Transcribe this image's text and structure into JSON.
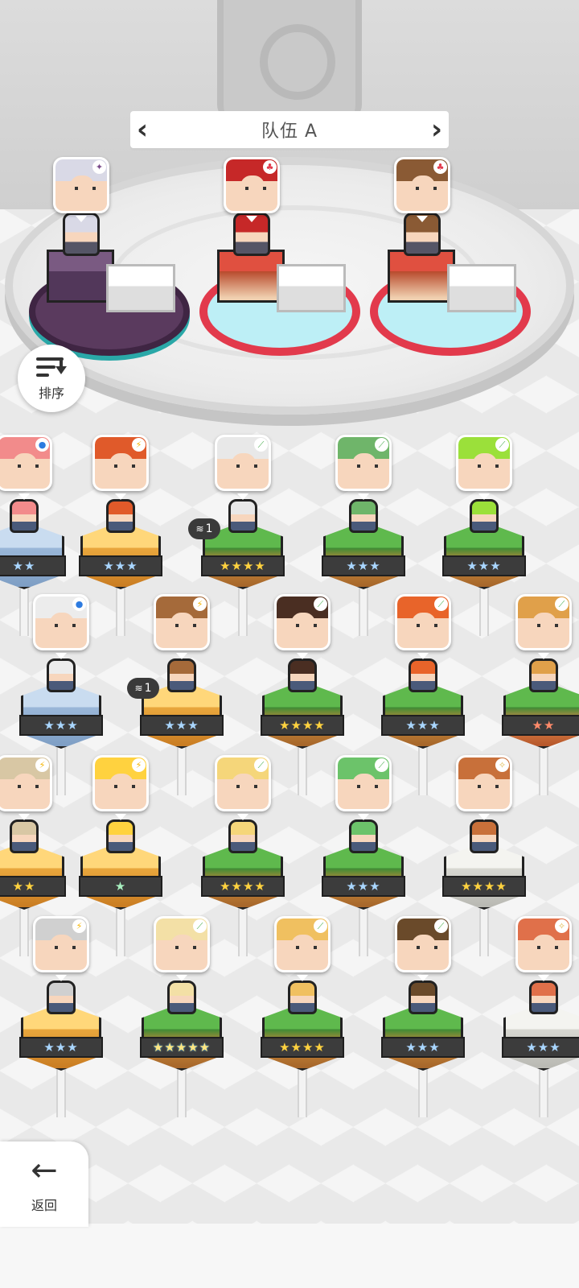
{
  "header": {
    "title": "队伍 A",
    "prev_icon": "chevron-left-icon",
    "next_icon": "chevron-right-icon"
  },
  "team_slots": [
    {
      "element_icon": "✦",
      "element_color": "#7a4a8a",
      "hair": "#d9d9e6",
      "theme": "dark"
    },
    {
      "element_icon": "♣",
      "element_color": "#e23a4c",
      "hair": "#c62828",
      "theme": "red"
    },
    {
      "element_icon": "♣",
      "element_color": "#e23a4c",
      "hair": "#8a5a34",
      "theme": "red"
    }
  ],
  "sort_button": {
    "label": "排序",
    "icon": "sort-icon"
  },
  "back_button": {
    "label": "返回",
    "icon": "arrow-left-icon"
  },
  "roster": [
    {
      "stars": "★★",
      "star_color": "blue",
      "pedestal": "blue",
      "element_icon": "●",
      "element_color": "#2d7be0",
      "hair": "#f28b8b"
    },
    {
      "stars": "★★★",
      "star_color": "blue",
      "pedestal": "gold",
      "element_icon": "⚡",
      "element_color": "#f5b400",
      "hair": "#e05a2a"
    },
    {
      "stars": "★★★★",
      "star_color": "gold",
      "pedestal": "green",
      "element_icon": "⟋",
      "element_color": "#4caf50",
      "hair": "#e8e8e8",
      "dup_count": "1"
    },
    {
      "stars": "★★★",
      "star_color": "blue",
      "pedestal": "green",
      "element_icon": "⟋",
      "element_color": "#4caf50",
      "hair": "#6fb56a"
    },
    {
      "stars": "★★★",
      "star_color": "blue",
      "pedestal": "green",
      "element_icon": "⟋",
      "element_color": "#4caf50",
      "hair": "#9be03a"
    },
    {
      "stars": "★★★",
      "star_color": "blue",
      "pedestal": "blue",
      "element_icon": "●",
      "element_color": "#2d7be0",
      "hair": "#ececec"
    },
    {
      "stars": "★★★",
      "star_color": "blue",
      "pedestal": "gold",
      "element_icon": "⚡",
      "element_color": "#f5b400",
      "hair": "#a56a3a",
      "dup_count": "1"
    },
    {
      "stars": "★★★★",
      "star_color": "gold",
      "pedestal": "green",
      "element_icon": "⟋",
      "element_color": "#4caf50",
      "hair": "#4a2e22"
    },
    {
      "stars": "★★★",
      "star_color": "blue",
      "pedestal": "green",
      "element_icon": "⟋",
      "element_color": "#4caf50",
      "hair": "#e8642a"
    },
    {
      "stars": "★★",
      "star_color": "red",
      "pedestal": "orange",
      "element_icon": "⟋",
      "element_color": "#4caf50",
      "hair": "#e0a04a"
    },
    {
      "stars": "★★",
      "star_color": "gold",
      "pedestal": "gold",
      "element_icon": "⚡",
      "element_color": "#f5b400",
      "hair": "#d8c7a4"
    },
    {
      "stars": "★",
      "star_color": "green",
      "pedestal": "gold",
      "element_icon": "⚡",
      "element_color": "#f5b400",
      "hair": "#ffd23f"
    },
    {
      "stars": "★★★★",
      "star_color": "gold",
      "pedestal": "green",
      "element_icon": "⟋",
      "element_color": "#4caf50",
      "hair": "#f5d67a"
    },
    {
      "stars": "★★★",
      "star_color": "blue",
      "pedestal": "green",
      "element_icon": "⟋",
      "element_color": "#4caf50",
      "hair": "#6cc36a"
    },
    {
      "stars": "★★★★",
      "star_color": "gold",
      "pedestal": "white",
      "element_icon": "✧",
      "element_color": "#e0b84a",
      "hair": "#c8703a"
    },
    {
      "stars": "★★★",
      "star_color": "blue",
      "pedestal": "gold",
      "element_icon": "⚡",
      "element_color": "#f5b400",
      "hair": "#d0d0d0"
    },
    {
      "stars": "★★★★★",
      "star_color": "rainbow",
      "pedestal": "green",
      "element_icon": "⟋",
      "element_color": "#4caf50",
      "hair": "#f3e0a6"
    },
    {
      "stars": "★★★★",
      "star_color": "gold",
      "pedestal": "green",
      "element_icon": "⟋",
      "element_color": "#4caf50",
      "hair": "#f0c060"
    },
    {
      "stars": "★★★",
      "star_color": "blue",
      "pedestal": "green",
      "element_icon": "⟋",
      "element_color": "#4caf50",
      "hair": "#6a4a2a"
    },
    {
      "stars": "★★★",
      "star_color": "blue",
      "pedestal": "white",
      "element_icon": "✧",
      "element_color": "#e0b84a",
      "hair": "#e0704a"
    }
  ]
}
